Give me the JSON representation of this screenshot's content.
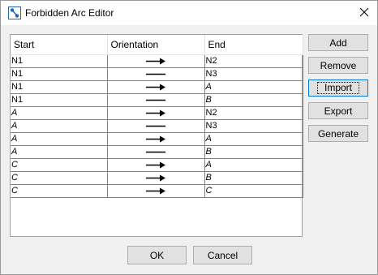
{
  "window": {
    "title": "Forbidden Arc Editor"
  },
  "icons": {
    "app": "graph-icon",
    "close": "close-icon"
  },
  "table": {
    "headers": {
      "start": "Start",
      "orientation": "Orientation",
      "end": "End"
    },
    "rows": [
      {
        "start": "N1",
        "start_italic": false,
        "orientation": "arrow",
        "end": "N2",
        "end_italic": false
      },
      {
        "start": "N1",
        "start_italic": false,
        "orientation": "line",
        "end": "N3",
        "end_italic": false
      },
      {
        "start": "N1",
        "start_italic": false,
        "orientation": "arrow",
        "end": "A",
        "end_italic": true
      },
      {
        "start": "N1",
        "start_italic": false,
        "orientation": "line",
        "end": "B",
        "end_italic": true
      },
      {
        "start": "A",
        "start_italic": true,
        "orientation": "arrow",
        "end": "N2",
        "end_italic": false
      },
      {
        "start": "A",
        "start_italic": true,
        "orientation": "line",
        "end": "N3",
        "end_italic": false
      },
      {
        "start": "A",
        "start_italic": true,
        "orientation": "arrow",
        "end": "A",
        "end_italic": true
      },
      {
        "start": "A",
        "start_italic": true,
        "orientation": "line",
        "end": "B",
        "end_italic": true
      },
      {
        "start": "C",
        "start_italic": true,
        "orientation": "arrow",
        "end": "A",
        "end_italic": true
      },
      {
        "start": "C",
        "start_italic": true,
        "orientation": "arrow",
        "end": "B",
        "end_italic": true
      },
      {
        "start": "C",
        "start_italic": true,
        "orientation": "arrow",
        "end": "C",
        "end_italic": true
      }
    ]
  },
  "side_buttons": {
    "add": "Add",
    "remove": "Remove",
    "import": "Import",
    "export": "Export",
    "generate": "Generate"
  },
  "footer_buttons": {
    "ok": "OK",
    "cancel": "Cancel"
  },
  "colors": {
    "focus_border": "#0078d7",
    "button_face": "#e1e1e1",
    "window_bg": "#f0f0f0",
    "icon_blue": "#1e64b4"
  }
}
